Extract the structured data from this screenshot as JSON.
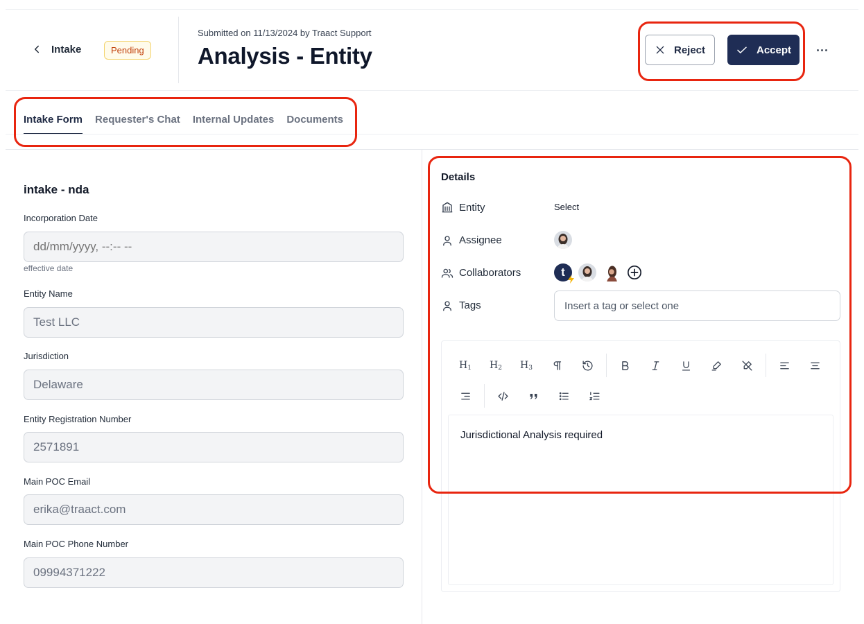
{
  "header": {
    "back_label": "Intake",
    "status_badge": "Pending",
    "submitted_text": "Submitted on 11/13/2024 by Traact Support",
    "title": "Analysis - Entity",
    "reject_label": "Reject",
    "accept_label": "Accept"
  },
  "tabs": [
    {
      "label": "Intake Form",
      "active": true
    },
    {
      "label": "Requester's Chat",
      "active": false
    },
    {
      "label": "Internal Updates",
      "active": false
    },
    {
      "label": "Documents",
      "active": false
    }
  ],
  "form": {
    "title": "intake - nda",
    "fields": [
      {
        "label": "Incorporation Date",
        "value": "",
        "placeholder": "dd/mm/yyyy, --:-- --",
        "help": "effective date"
      },
      {
        "label": "Entity Name",
        "value": "Test LLC"
      },
      {
        "label": "Jurisdiction",
        "value": "Delaware"
      },
      {
        "label": "Entity Registration Number",
        "value": "2571891"
      },
      {
        "label": "Main POC Email",
        "value": "erika@traact.com"
      },
      {
        "label": "Main POC Phone Number",
        "value": "09994371222"
      }
    ]
  },
  "details": {
    "title": "Details",
    "entity_label": "Entity",
    "entity_value": "Select",
    "assignee_label": "Assignee",
    "collaborators_label": "Collaborators",
    "collaborator_initial": "t",
    "tags_label": "Tags",
    "tags_placeholder": "Insert a tag or select one",
    "editor_content": "Jurisdictional Analysis required"
  },
  "colors": {
    "primary": "#1f2d55",
    "badge_text": "#c2410c",
    "badge_bg": "#fffbeb",
    "annotation": "#e8250f"
  },
  "icons": [
    "chevron-left-icon",
    "close-icon",
    "check-icon",
    "more-horizontal-icon",
    "building-icon",
    "user-icon",
    "users-icon",
    "plus-circle-icon"
  ]
}
